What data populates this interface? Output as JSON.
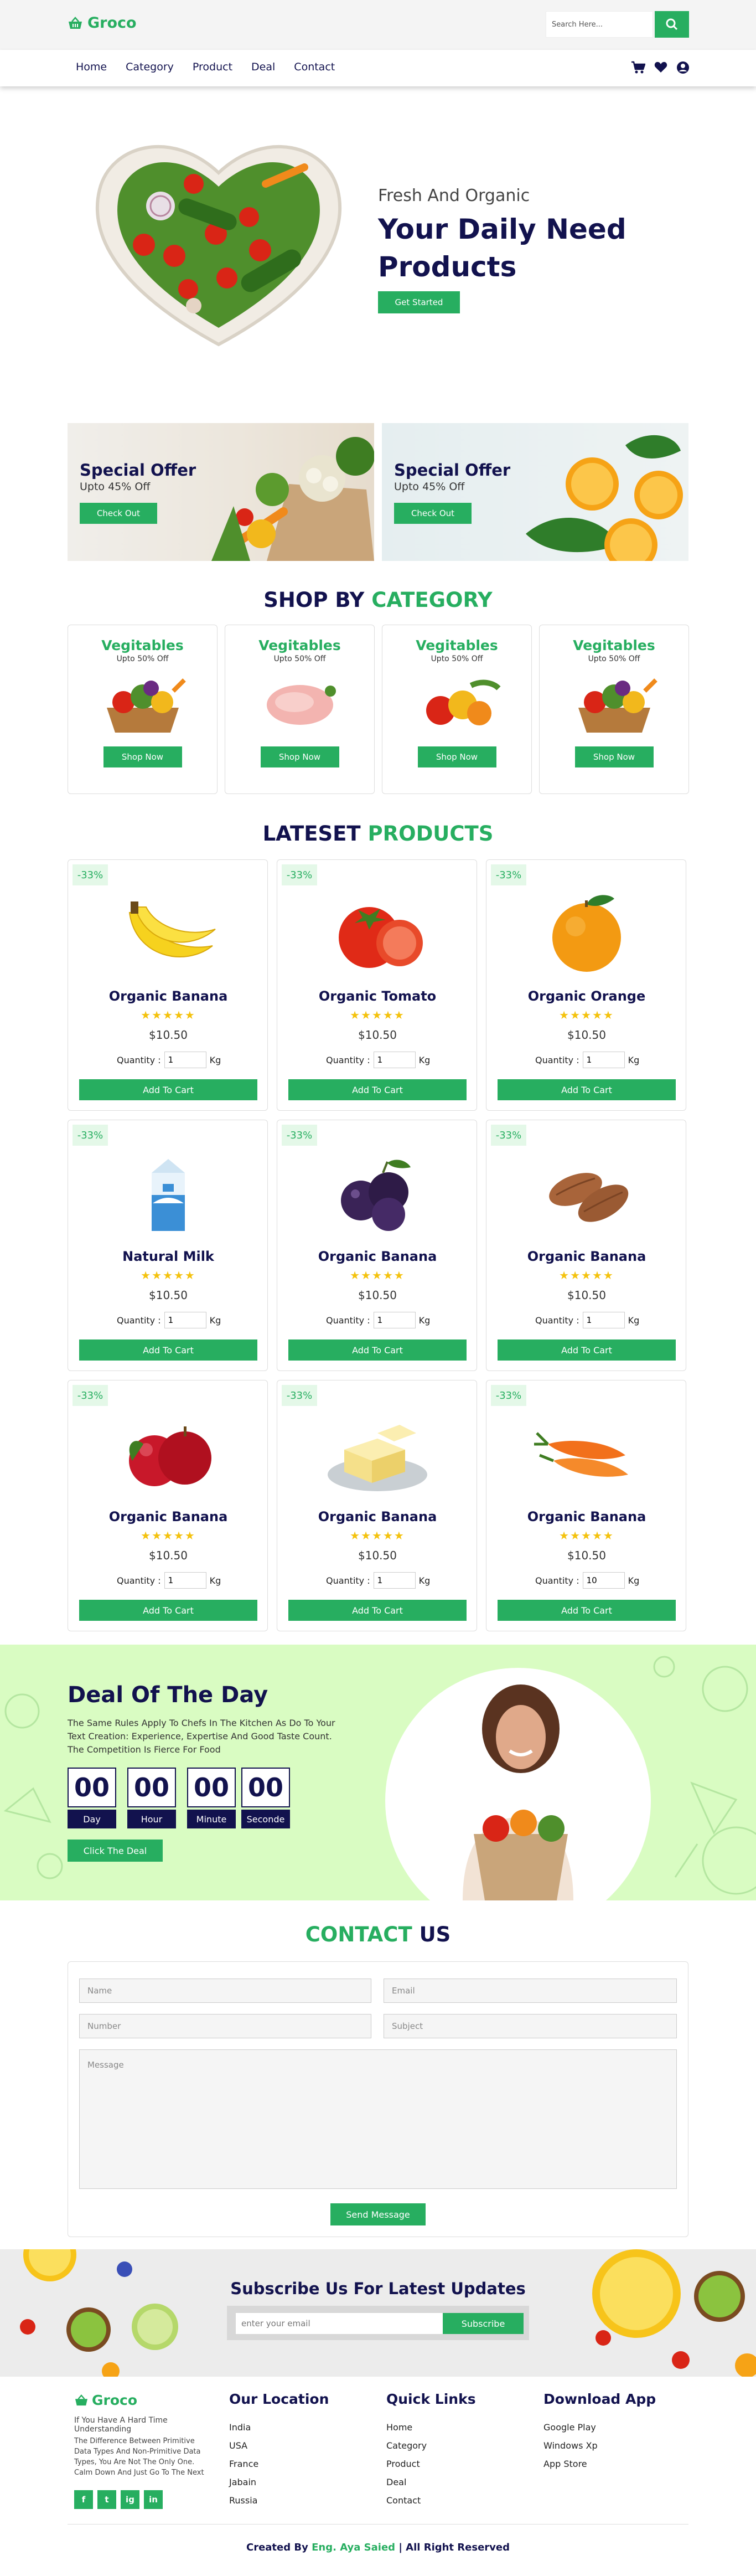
{
  "header": {
    "brand": "Groco",
    "search_placeholder": "Search Here...",
    "nav": [
      "Home",
      "Category",
      "Product",
      "Deal",
      "Contact"
    ]
  },
  "hero": {
    "subtitle": "Fresh And Organic",
    "title": "Your Daily Need Products",
    "button": "Get Started"
  },
  "offers": [
    {
      "title": "Special Offer",
      "subtitle": "Upto 45% Off",
      "button": "Check Out"
    },
    {
      "title": "Special Offer",
      "subtitle": "Upto 45% Off",
      "button": "Check Out"
    }
  ],
  "category_section": {
    "title_a": "SHOP BY",
    "title_b": "CATEGORY"
  },
  "categories": [
    {
      "title": "Vegitables",
      "subtitle": "Upto 50% Off",
      "button": "Shop Now"
    },
    {
      "title": "Vegitables",
      "subtitle": "Upto 50% Off",
      "button": "Shop Now"
    },
    {
      "title": "Vegitables",
      "subtitle": "Upto 50% Off",
      "button": "Shop Now"
    },
    {
      "title": "Vegitables",
      "subtitle": "Upto 50% Off",
      "button": "Shop Now"
    }
  ],
  "products_section": {
    "title_a": "LATESET",
    "title_b": "PRODUCTS"
  },
  "product_common": {
    "quantity_label": "Quantity :",
    "unit": "Kg",
    "button": "Add To Cart",
    "stars": "★★★★★"
  },
  "products": [
    {
      "discount": "-33%",
      "name": "Organic Banana",
      "price": "$10.50",
      "qty": "1",
      "rating": 4.5
    },
    {
      "discount": "-33%",
      "name": "Organic Tomato",
      "price": "$10.50",
      "qty": "1",
      "rating": 4.5
    },
    {
      "discount": "-33%",
      "name": "Organic Orange",
      "price": "$10.50",
      "qty": "1",
      "rating": 4.5
    },
    {
      "discount": "-33%",
      "name": "Natural Milk",
      "price": "$10.50",
      "qty": "1",
      "rating": 4.5
    },
    {
      "discount": "-33%",
      "name": "Organic Banana",
      "price": "$10.50",
      "qty": "1",
      "rating": 4.5
    },
    {
      "discount": "-33%",
      "name": "Organic Banana",
      "price": "$10.50",
      "qty": "1",
      "rating": 4.5
    },
    {
      "discount": "-33%",
      "name": "Organic Banana",
      "price": "$10.50",
      "qty": "1",
      "rating": 4.5
    },
    {
      "discount": "-33%",
      "name": "Organic Banana",
      "price": "$10.50",
      "qty": "1",
      "rating": 4.5
    },
    {
      "discount": "-33%",
      "name": "Organic Banana",
      "price": "$10.50",
      "qty": "10",
      "rating": 4.5
    }
  ],
  "deal": {
    "title": "Deal Of The Day",
    "text": "The Same Rules Apply To Chefs In The Kitchen As Do To Your Text Creation: Experience, Expertise And Good Taste Count. The Competition Is Fierce For Food",
    "countdown": [
      {
        "value": "00",
        "label": "Day"
      },
      {
        "value": "00",
        "label": "Hour"
      },
      {
        "value": "00",
        "label": "Minute"
      },
      {
        "value": "00",
        "label": "Seconde"
      }
    ],
    "button": "Click The Deal"
  },
  "contact": {
    "title_a": "CONTACT",
    "title_b": "US",
    "name_placeholder": "Name",
    "email_placeholder": "Email",
    "number_placeholder": "Number",
    "subject_placeholder": "Subject",
    "message_placeholder": "Message",
    "button": "Send Message"
  },
  "subscribe": {
    "title": "Subscribe Us For Latest Updates",
    "placeholder": "enter your email",
    "button": "Subscribe"
  },
  "footer": {
    "brand": "Groco",
    "tagline": "If You Have A Hard Time Understanding",
    "text": "The Difference Between Primitive Data Types And Non-Primitive Data Types, You Are Not The Only One. Calm Down And Just Go To The Next",
    "social": [
      "f",
      "t",
      "ig",
      "in"
    ],
    "location_title": "Our Location",
    "locations": [
      "India",
      "USA",
      "France",
      "Jabain",
      "Russia"
    ],
    "links_title": "Quick Links",
    "links": [
      "Home",
      "Category",
      "Product",
      "Deal",
      "Contact"
    ],
    "app_title": "Download App",
    "apps": [
      "Google Play",
      "Windows Xp",
      "App Store"
    ],
    "credit_a": "Created By",
    "credit_name": "Eng. Aya Saied",
    "credit_b": "| All Right Reserved"
  },
  "colors": {
    "green": "#27ae60",
    "navy": "#12124e",
    "deal_bg": "#d9fcc2"
  }
}
